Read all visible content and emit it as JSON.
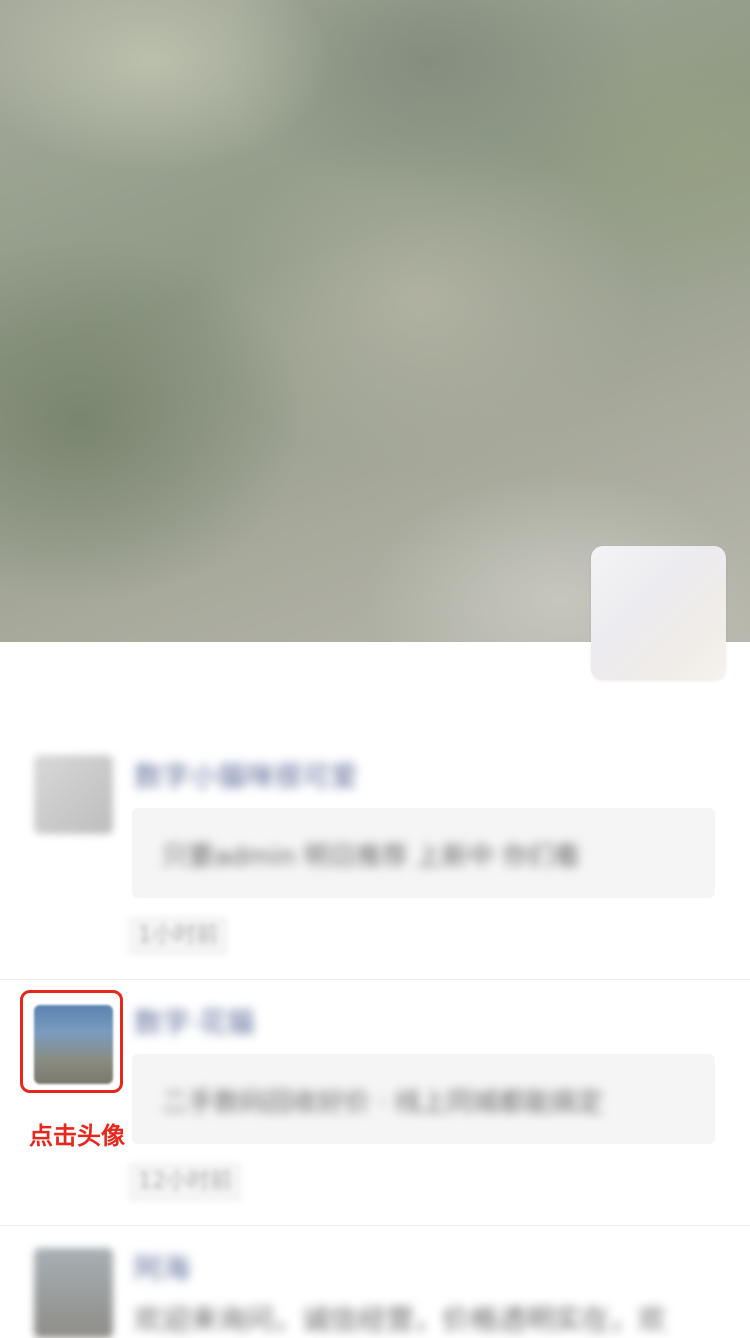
{
  "cover": {
    "image": "blurred-cover-photo"
  },
  "owner": {
    "avatar": "profile-avatar"
  },
  "posts": [
    {
      "name": "数字小猫咪很可爱",
      "content": "只要admin 明日推荐 上新中 你们看",
      "time": "1小时前",
      "avatar_colors": [
        "#d8d8d8",
        "#bdbdbd"
      ]
    },
    {
      "name": "数字·花猫",
      "content": "二手数码回收好价 · 线上同城都能搞定",
      "time": "12小时前",
      "avatar_colors": [
        "#6d8fb3",
        "#8a8678"
      ]
    },
    {
      "name": "阿海",
      "content": "欢迎来询问，诚信经营，价格透明实在，欢",
      "time": "",
      "avatar_colors": [
        "#9aa3a8",
        "#8e8c88"
      ]
    }
  ],
  "annotation": {
    "hint_text": "点击头像",
    "color": "#e8271c"
  }
}
